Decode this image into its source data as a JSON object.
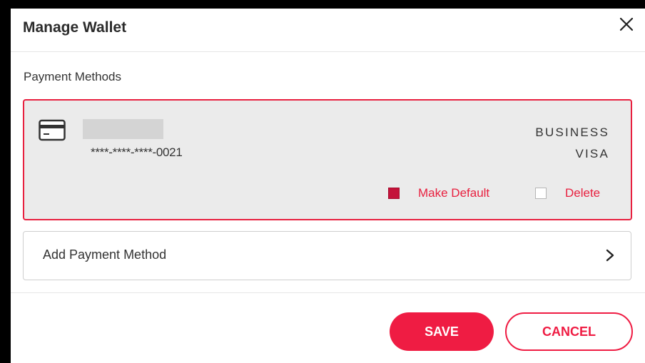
{
  "dialog": {
    "title": "Manage Wallet",
    "close_icon": "close-icon"
  },
  "payment_methods": {
    "section_label": "Payment Methods",
    "card": {
      "icon": "credit-card-icon",
      "masked_number": "****-****-****-0021",
      "type_line1": "BUSINESS",
      "type_line2": "VISA",
      "make_default_label": "Make Default",
      "make_default_checked": true,
      "delete_label": "Delete",
      "delete_checked": false
    },
    "add_label": "Add Payment Method",
    "add_icon": "chevron-right-icon"
  },
  "footer": {
    "save_label": "SAVE",
    "cancel_label": "CANCEL"
  },
  "colors": {
    "accent": "#ef1c43",
    "card_bg": "#ebebeb",
    "checkbox_checked": "#c4123a"
  }
}
